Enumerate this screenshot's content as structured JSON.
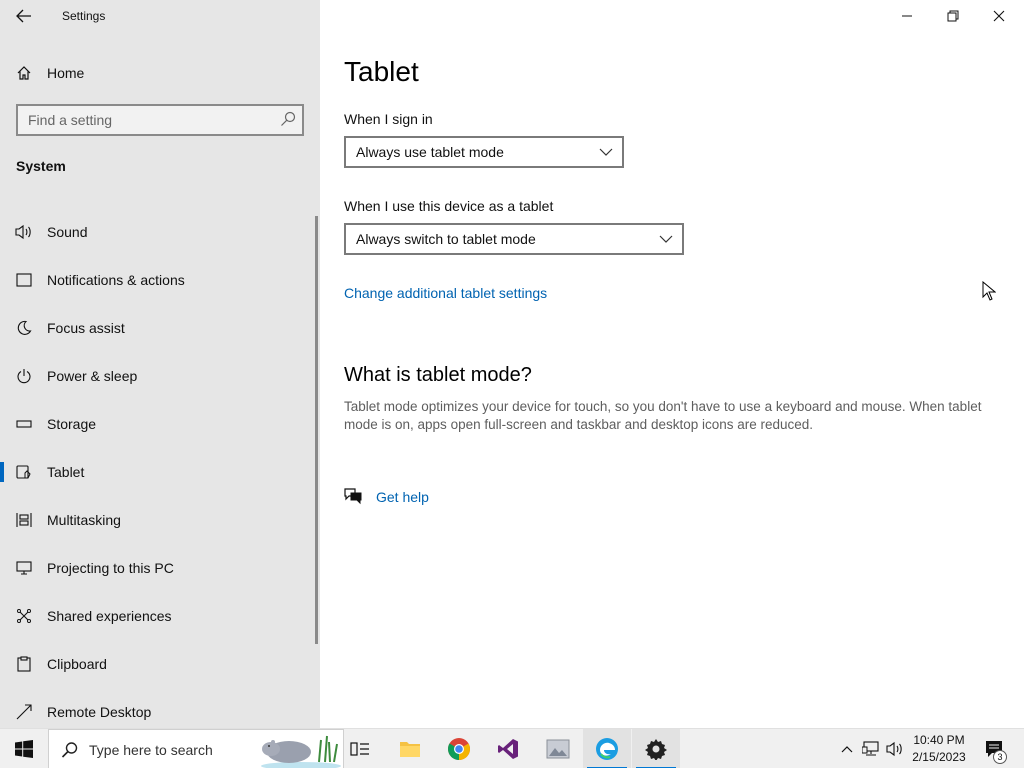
{
  "window": {
    "title": "Settings",
    "controls": [
      "minimize-icon",
      "restore-icon",
      "close-icon"
    ]
  },
  "sidebar": {
    "home_label": "Home",
    "search_placeholder": "Find a setting",
    "section_title": "System",
    "items": [
      {
        "label": "Sound",
        "icon": "speaker-icon",
        "selected": false
      },
      {
        "label": "Notifications & actions",
        "icon": "notification-icon",
        "selected": false
      },
      {
        "label": "Focus assist",
        "icon": "moon-icon",
        "selected": false
      },
      {
        "label": "Power & sleep",
        "icon": "power-icon",
        "selected": false
      },
      {
        "label": "Storage",
        "icon": "storage-icon",
        "selected": false
      },
      {
        "label": "Tablet",
        "icon": "tablet-icon",
        "selected": true
      },
      {
        "label": "Multitasking",
        "icon": "multitasking-icon",
        "selected": false
      },
      {
        "label": "Projecting to this PC",
        "icon": "projecting-icon",
        "selected": false
      },
      {
        "label": "Shared experiences",
        "icon": "shared-icon",
        "selected": false
      },
      {
        "label": "Clipboard",
        "icon": "clipboard-icon",
        "selected": false
      },
      {
        "label": "Remote Desktop",
        "icon": "remote-desktop-icon",
        "selected": false
      }
    ]
  },
  "main": {
    "title": "Tablet",
    "sign_in": {
      "label": "When I sign in",
      "value": "Always use tablet mode"
    },
    "use_as_tablet": {
      "label": "When I use this device as a tablet",
      "value": "Always switch to tablet mode"
    },
    "additional_link": "Change additional tablet settings",
    "what_is_title": "What is tablet mode?",
    "what_is_desc": "Tablet mode optimizes your device for touch, so you don't have to use a keyboard and mouse. When tablet mode is on, apps open full-screen and taskbar and desktop icons are reduced.",
    "help_link": "Get help"
  },
  "taskbar": {
    "search_placeholder": "Type here to search",
    "apps": [
      "task-view-icon",
      "file-explorer-icon",
      "chrome-icon",
      "visual-studio-icon",
      "photos-icon",
      "edge-icon",
      "settings-icon"
    ],
    "time": "10:40 PM",
    "date": "2/15/2023",
    "notification_count": "3"
  },
  "colors": {
    "accent": "#0067c0",
    "link": "#0063b1",
    "sidebar_bg": "#e6e6e6"
  }
}
